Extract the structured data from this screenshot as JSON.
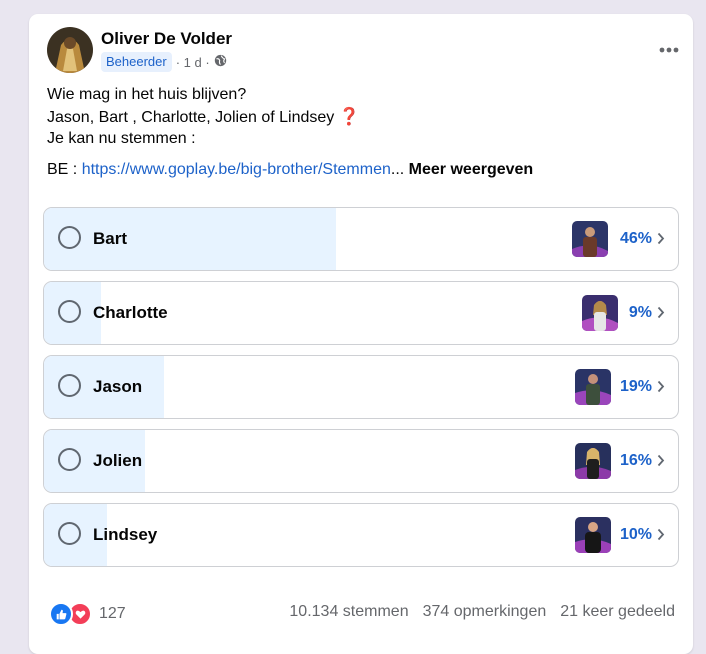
{
  "post": {
    "author": "Oliver De Volder",
    "role_badge": "Beheerder",
    "time": "· 1 d ·",
    "text_lines": [
      "Wie mag in het huis blijven?",
      "Jason, Bart , Charlotte,  Jolien of Lindsey",
      "Je kan nu stemmen :"
    ],
    "question_mark": "❓",
    "link_prefix": "BE : ",
    "link_text": "https://www.goplay.be/big-brother/Stemmen",
    "ellipsis": "...",
    "see_more": "Meer weergeven"
  },
  "poll": {
    "options": [
      {
        "label": "Bart",
        "percent": "46%",
        "fill": 0.46
      },
      {
        "label": "Charlotte",
        "percent": "9%",
        "fill": 0.09
      },
      {
        "label": "Jason",
        "percent": "19%",
        "fill": 0.19
      },
      {
        "label": "Jolien",
        "percent": "16%",
        "fill": 0.16
      },
      {
        "label": "Lindsey",
        "percent": "10%",
        "fill": 0.1
      }
    ]
  },
  "footer": {
    "reaction_count": "127",
    "votes": "10.134 stemmen",
    "comments": "374 opmerkingen",
    "shares": "21 keer gedeeld"
  },
  "colors": {
    "accent": "#1d62c9",
    "fill": "#e7f3ff",
    "background": "#e9e6f0"
  }
}
